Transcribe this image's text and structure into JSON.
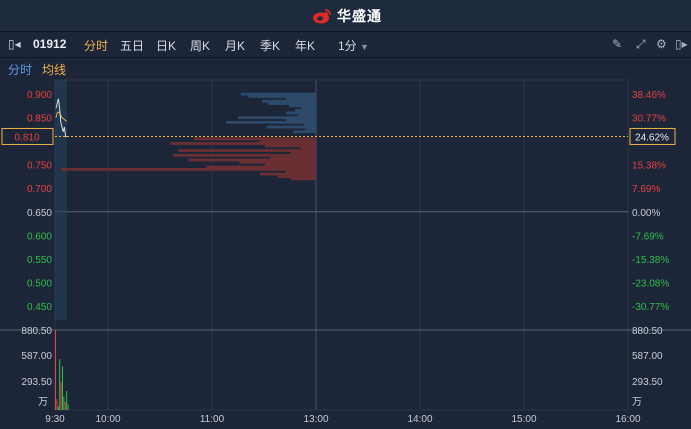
{
  "app": {
    "brand": "华盛通"
  },
  "toolbar": {
    "stock_code": "01912",
    "tabs": [
      "分时",
      "五日",
      "日K",
      "周K",
      "月K",
      "季K",
      "年K"
    ],
    "active_tab": "分时",
    "interval": "1分"
  },
  "subbar": {
    "mode": "分时",
    "avg_line": "均线"
  },
  "colors": {
    "up": "#e84040",
    "down": "#2fbf4a",
    "flat": "#c8cdd6",
    "accent": "#f2b14c",
    "price_line": "#d8e0ea",
    "ask_bar": "#2d4a6b",
    "bid_bar": "#6a2f33"
  },
  "price_axis": {
    "left": [
      "0.900",
      "0.850",
      "0.750",
      "0.700",
      "0.650",
      "0.600",
      "0.550",
      "0.500",
      "0.450"
    ],
    "right": [
      "38.46%",
      "30.77%",
      "15.38%",
      "7.69%",
      "0.00%",
      "-7.69%",
      "-15.38%",
      "-23.08%",
      "-30.77%"
    ],
    "values": [
      0.9,
      0.85,
      0.75,
      0.7,
      0.65,
      0.6,
      0.55,
      0.5,
      0.45
    ],
    "current_price": "0.810",
    "current_pct": "24.62%",
    "prev_close": 0.65
  },
  "volume_axis": {
    "left": [
      "880.50",
      "587.00",
      "293.50"
    ],
    "right": [
      "880.50",
      "587.00",
      "293.50"
    ],
    "unit": "万"
  },
  "time_axis": [
    "9:30",
    "10:00",
    "11:00",
    "13:00",
    "14:00",
    "15:00",
    "16:00"
  ],
  "chart_data": {
    "type": "line",
    "price_series": [
      0.87,
      0.88,
      0.89,
      0.87,
      0.84,
      0.83,
      0.82,
      0.83,
      0.81,
      0.81
    ],
    "avg_series": [
      0.85,
      0.86,
      0.862,
      0.86,
      0.855,
      0.85,
      0.848,
      0.846,
      0.844,
      0.842
    ],
    "volume_series": [
      880,
      120,
      40,
      560,
      310,
      480,
      150,
      90,
      210,
      60
    ],
    "ylim": [
      0.42,
      0.93
    ],
    "volume_max": 880.5,
    "depth_asks": [
      {
        "price": 0.9,
        "size": 0.5
      },
      {
        "price": 0.895,
        "size": 0.45
      },
      {
        "price": 0.89,
        "size": 0.2
      },
      {
        "price": 0.885,
        "size": 0.36
      },
      {
        "price": 0.88,
        "size": 0.32
      },
      {
        "price": 0.875,
        "size": 0.18
      },
      {
        "price": 0.87,
        "size": 0.1
      },
      {
        "price": 0.865,
        "size": 0.14
      },
      {
        "price": 0.86,
        "size": 0.2
      },
      {
        "price": 0.855,
        "size": 0.12
      },
      {
        "price": 0.85,
        "size": 0.52
      },
      {
        "price": 0.845,
        "size": 0.2
      },
      {
        "price": 0.84,
        "size": 0.6
      },
      {
        "price": 0.835,
        "size": 0.08
      },
      {
        "price": 0.83,
        "size": 0.33
      },
      {
        "price": 0.825,
        "size": 0.07
      },
      {
        "price": 0.82,
        "size": 0.15
      }
    ],
    "depth_bids": [
      {
        "price": 0.805,
        "size": 0.48
      },
      {
        "price": 0.8,
        "size": 0.22
      },
      {
        "price": 0.795,
        "size": 0.57
      },
      {
        "price": 0.79,
        "size": 0.2
      },
      {
        "price": 0.785,
        "size": 0.06
      },
      {
        "price": 0.78,
        "size": 0.54
      },
      {
        "price": 0.775,
        "size": 0.1
      },
      {
        "price": 0.77,
        "size": 0.56
      },
      {
        "price": 0.765,
        "size": 0.18
      },
      {
        "price": 0.76,
        "size": 0.5
      },
      {
        "price": 0.755,
        "size": 0.3
      },
      {
        "price": 0.75,
        "size": 0.2
      },
      {
        "price": 0.745,
        "size": 0.43
      },
      {
        "price": 0.74,
        "size": 1.0
      },
      {
        "price": 0.735,
        "size": 0.12
      },
      {
        "price": 0.73,
        "size": 0.22
      },
      {
        "price": 0.725,
        "size": 0.15
      },
      {
        "price": 0.72,
        "size": 0.1
      }
    ]
  }
}
